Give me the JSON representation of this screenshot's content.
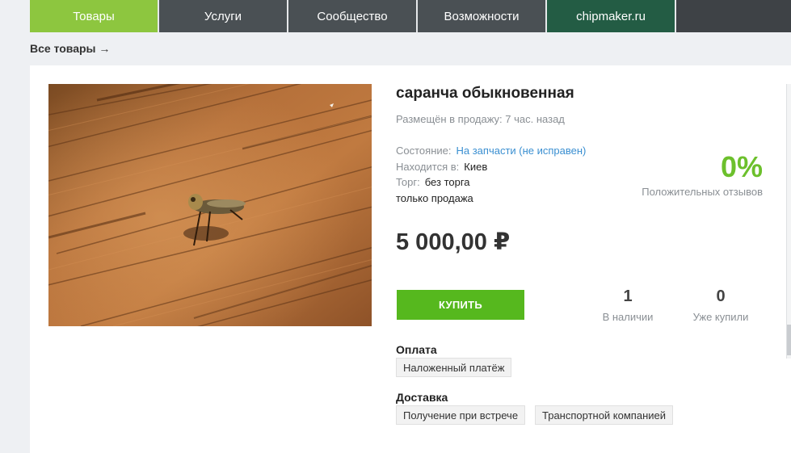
{
  "nav": {
    "tabs": [
      {
        "label": "Товары"
      },
      {
        "label": "Услуги"
      },
      {
        "label": "Сообщество"
      },
      {
        "label": "Возможности"
      },
      {
        "label": "chipmaker.ru"
      }
    ]
  },
  "breadcrumb": {
    "label": "Все товары →"
  },
  "product": {
    "title": "саранча обыкновенная",
    "posted": "Размещён в продажу: 7 час. назад",
    "condition_label": "Состояние:",
    "condition_value": "На запчасти (не исправен)",
    "location_label": "Находится в:",
    "location_value": "Киев",
    "bargain_label": "Торг:",
    "bargain_value": "без торга",
    "sale_type": "только продажа",
    "price": "5 000,00 ₽",
    "buy_label": "КУПИТЬ",
    "image_subject": "locust-photo"
  },
  "seller": {
    "feedback_percent": "0%",
    "feedback_label": "Положительных отзывов"
  },
  "stats": {
    "in_stock_value": "1",
    "in_stock_label": "В наличии",
    "sold_value": "0",
    "sold_label": "Уже купили"
  },
  "payment": {
    "title": "Оплата",
    "options": [
      "Наложенный платёж"
    ]
  },
  "delivery": {
    "title": "Доставка",
    "options": [
      "Получение при встрече",
      "Транспортной компанией"
    ]
  },
  "colors": {
    "accent_green": "#8dc63f",
    "buy_green": "#56b81e",
    "nav_dark": "#4a5054",
    "nav_brand": "#235c44",
    "link_blue": "#3a8fd1"
  }
}
